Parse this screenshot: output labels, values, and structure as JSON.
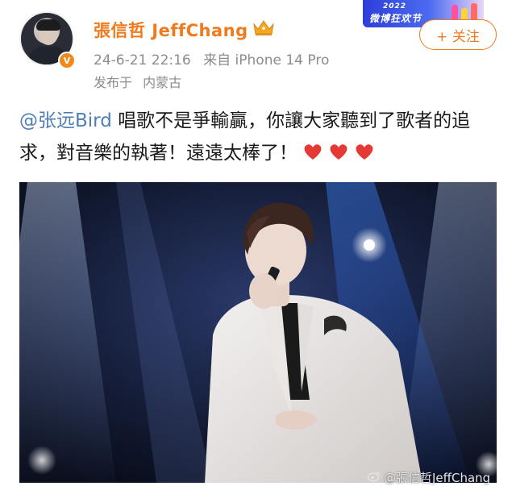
{
  "user": {
    "name": "張信哲 JeffChang",
    "verified_badge": "V"
  },
  "meta": {
    "date": "24-6-21 22:16",
    "source": "来自 iPhone 14 Pro",
    "location_prefix": "发布于",
    "location": "内蒙古"
  },
  "event_badge": {
    "year": "2022",
    "name": "微博狂欢节"
  },
  "follow_label": "+ 关注",
  "post": {
    "mention": "@张远Bird",
    "text": " 唱歌不是爭輸贏，你讓大家聽到了歌者的追求，對音樂的執著！遠遠太棒了！"
  },
  "media": {
    "watermark": "@張信哲JeffChang"
  },
  "colors": {
    "accent": "#f07a1e",
    "mention": "#4f7db6",
    "meta": "#8c8c8c",
    "heart": "#e53935"
  },
  "icons": [
    "crown-icon",
    "verified-icon",
    "heart-icon",
    "weibo-icon"
  ]
}
